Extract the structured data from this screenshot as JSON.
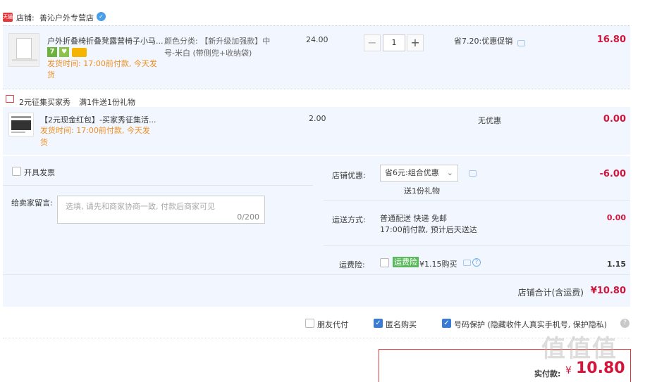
{
  "shop": {
    "badge": "天猫",
    "label": "店铺:",
    "name": "善沁户外专营店"
  },
  "item1": {
    "title": "户外折叠椅折叠凳露营椅子小马...",
    "attr_line1": "颜色分类: 【新升级加强款】中",
    "attr_line2": "号-米白 (带侧兜+收纳袋)",
    "price": "24.00",
    "qty": "1",
    "promo": "省7.20:优惠促销",
    "total": "16.80",
    "ship_line1": "发货时间: 17:00前付款, 今天发",
    "ship_line2": "货",
    "icon_badge_7": "7"
  },
  "gift": {
    "title": "2元征集买家秀",
    "desc": "满1件送1份礼物"
  },
  "item2": {
    "title": "【2元现金红包】-买家秀征集活...",
    "price": "2.00",
    "promo": "无优惠",
    "total": "0.00",
    "ship_line1": "发货时间: 17:00前付款, 今天发",
    "ship_line2": "货"
  },
  "invoice": {
    "label": "开具发票"
  },
  "message": {
    "label": "给卖家留言:",
    "placeholder": "选填, 请先和商家协商一致, 付款后商家可见",
    "counter": "0/200"
  },
  "discount": {
    "label": "店铺优惠:",
    "selected": "省6元:组合优惠",
    "sub": "送1份礼物",
    "value": "-6.00"
  },
  "shipping": {
    "label": "运送方式:",
    "line1": "普通配送 快递 免邮",
    "line2": "17:00前付款, 预计后天送达",
    "value": "0.00"
  },
  "insurance": {
    "label": "运费险:",
    "tag": "运费险",
    "price": "¥1.15购买",
    "value": "1.15"
  },
  "subtotal": {
    "label": "店铺合计(含运费)",
    "value": "¥10.80"
  },
  "options": {
    "friend_pay": "朋友代付",
    "anonymous": "匿名购买",
    "number_protect": "号码保护 (隐藏收件人真实手机号, 保护隐私)"
  },
  "payment": {
    "label": "实付款:",
    "currency": "¥",
    "value": "10.80"
  },
  "watermark": "值值值"
}
